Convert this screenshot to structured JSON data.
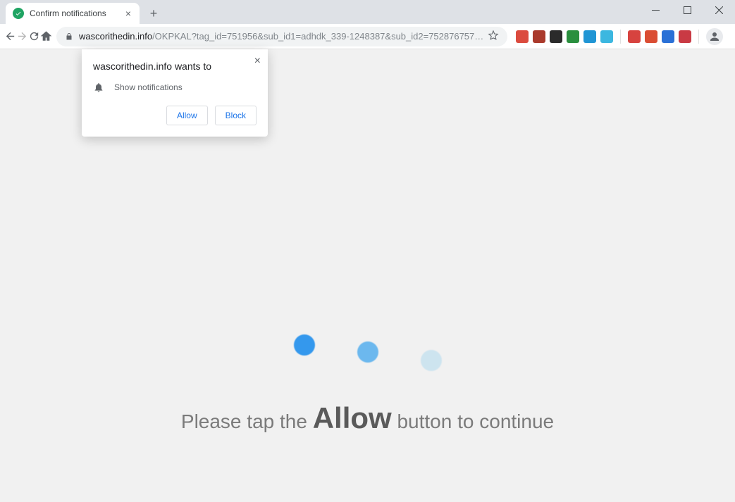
{
  "tab": {
    "title": "Confirm notifications"
  },
  "window_controls": {
    "minimize": "minimize",
    "maximize": "maximize",
    "close": "close"
  },
  "address": {
    "host": "wascorithedin.info",
    "path": "/OKPKAL?tag_id=751956&sub_id1=adhdk_339-1248387&sub_id2=752876757…"
  },
  "extensions": [
    {
      "name": "ext-1",
      "color": "#db4b3e"
    },
    {
      "name": "ext-2",
      "color": "#aa3a2c"
    },
    {
      "name": "ext-3",
      "color": "#2b2b2b"
    },
    {
      "name": "ext-4",
      "color": "#2a8f3e"
    },
    {
      "name": "ext-5",
      "color": "#2095d4"
    },
    {
      "name": "ext-6",
      "color": "#3cb7e0"
    },
    {
      "name": "ext-7",
      "color": "#d7433f"
    },
    {
      "name": "ext-8",
      "color": "#da4d33"
    },
    {
      "name": "ext-9",
      "color": "#2a70d6"
    },
    {
      "name": "ext-10",
      "color": "#c93a44"
    }
  ],
  "permission": {
    "origin_wants": "wascorithedin.info wants to",
    "prompt": "Show notifications",
    "allow": "Allow",
    "block": "Block"
  },
  "page": {
    "prefix": "Please tap the ",
    "emphasis": "Allow",
    "suffix": " button to continue"
  }
}
